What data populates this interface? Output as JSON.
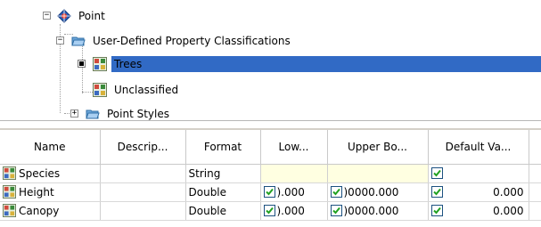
{
  "tree": {
    "nodes": [
      {
        "label": "Point",
        "icon": "point-style-icon",
        "expander": "minus"
      },
      {
        "label": "User-Defined Property Classifications",
        "icon": "folder-icon",
        "expander": "minus"
      },
      {
        "label": "Trees",
        "icon": "classification-icon",
        "expander": "bullet",
        "selected": true
      },
      {
        "label": "Unclassified",
        "icon": "classification-icon",
        "expander": "none"
      },
      {
        "label": "Point Styles",
        "icon": "folder-icon",
        "expander": "plus"
      }
    ],
    "selection_color": "#316ac5"
  },
  "grid": {
    "columns": [
      "Name",
      "Descrip...",
      "Format",
      "Low...",
      "Upper Bo...",
      "Default Va..."
    ],
    "rows": [
      {
        "name": "Species",
        "description": "",
        "format": "String",
        "low_checked": null,
        "low": "",
        "upper_checked": null,
        "upper": "",
        "default_checked": true,
        "default": ""
      },
      {
        "name": "Height",
        "description": "",
        "format": "Double",
        "low_checked": true,
        "low": ").000",
        "upper_checked": true,
        "upper": ")0000.000",
        "default_checked": true,
        "default": "0.000"
      },
      {
        "name": "Canopy",
        "description": "",
        "format": "Double",
        "low_checked": true,
        "low": ").000",
        "upper_checked": true,
        "upper": ")0000.000",
        "default_checked": true,
        "default": "0.000"
      }
    ],
    "highlight_color": "#ffffe1"
  }
}
